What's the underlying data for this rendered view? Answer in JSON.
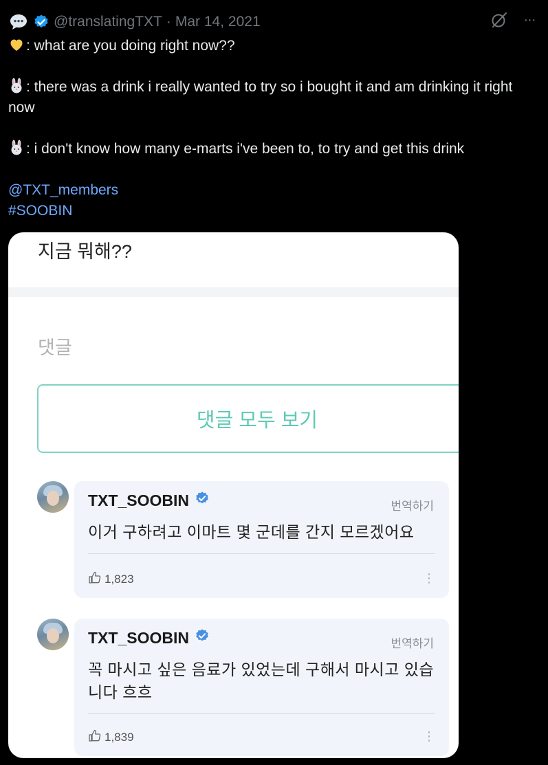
{
  "tweet": {
    "handle": "@translatingTXT",
    "separator": "·",
    "date": "Mar 14, 2021",
    "more_label": "···",
    "lines": [
      ": what are you doing right now??",
      ": there was a drink i really wanted to try so i bought it and am drinking it right now",
      ": i don't know how many e-marts i've been to, to try and get this drink"
    ],
    "mention": "@TXT_members",
    "hashtag": "#SOOBIN"
  },
  "card": {
    "post_body": "지금 뭐해??",
    "comments_label": "댓글",
    "view_all_label": "댓글 모두 보기",
    "comments": [
      {
        "author": "TXT_SOOBIN",
        "translate_label": "번역하기",
        "text": "이거 구하려고 이마트 몇 군데를 간지 모르겠어요",
        "likes": "1,823"
      },
      {
        "author": "TXT_SOOBIN",
        "translate_label": "번역하기",
        "text": "꼭 마시고 싶은 음료가 있었는데 구해서 마시고 있습니다 흐흐",
        "likes": "1,839"
      }
    ]
  },
  "colors": {
    "background": "#000000",
    "link": "#6ea8fe",
    "accent_teal": "#5fc9b4",
    "verified": "#1d9bf0",
    "comment_bubble": "#f1f5fb"
  },
  "icons": [
    "speech-bubble-icon",
    "verified-icon",
    "grok-icon",
    "more-icon",
    "yellow-heart-icon",
    "rabbit-icon",
    "thumbs-up-icon",
    "kebab-menu-icon"
  ]
}
